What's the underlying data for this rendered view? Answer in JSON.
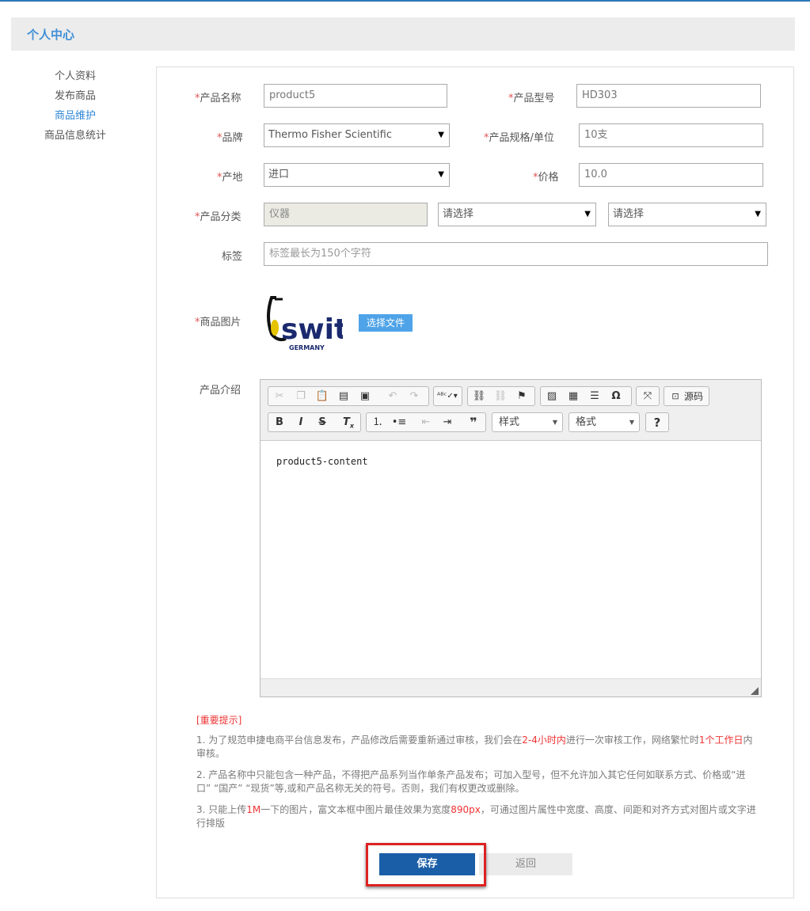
{
  "header": {
    "title": "个人中心"
  },
  "sidebar": {
    "items": [
      {
        "label": "个人资料",
        "active": false
      },
      {
        "label": "发布商品",
        "active": false
      },
      {
        "label": "商品维护",
        "active": true
      },
      {
        "label": "商品信息统计",
        "active": false
      }
    ]
  },
  "form": {
    "required_mark": "*",
    "product_name": {
      "label": "产品名称",
      "value": "product5"
    },
    "product_model": {
      "label": "产品型号",
      "value": "HD303"
    },
    "brand": {
      "label": "品牌",
      "value": "Thermo Fisher Scientific"
    },
    "spec_unit": {
      "label": "产品规格/单位",
      "value": "10支"
    },
    "origin": {
      "label": "产地",
      "value": "进口"
    },
    "price": {
      "label": "价格",
      "value": "10.0"
    },
    "category": {
      "label": "产品分类",
      "value": "仪器",
      "sub1": "请选择",
      "sub2": "请选择"
    },
    "tags": {
      "label": "标签",
      "placeholder": "标签最长为150个字符"
    },
    "image": {
      "label": "商品图片",
      "choose_file": "选择文件",
      "logo_text": "switeg",
      "logo_sub": "GERMANY"
    },
    "intro": {
      "label": "产品介绍",
      "content": "product5-content"
    }
  },
  "editor": {
    "source_label": "源码",
    "styles_label": "样式",
    "format_label": "格式",
    "help_label": "?",
    "icons": [
      "cut-icon",
      "copy-icon",
      "paste-icon",
      "paste-text-icon",
      "paste-word-icon",
      "undo-icon",
      "redo-icon",
      "spellcheck-icon",
      "link-icon",
      "unlink-icon",
      "anchor-icon",
      "image-icon",
      "table-icon",
      "hr-icon",
      "special-char-icon",
      "maximize-icon",
      "bold-icon",
      "italic-icon",
      "strike-icon",
      "remove-format-icon",
      "numbered-list-icon",
      "bulleted-list-icon",
      "outdent-icon",
      "indent-icon",
      "blockquote-icon"
    ]
  },
  "notice": {
    "title": "[重要提示]",
    "p1": {
      "a": "1. 为了规范申捷电商平台信息发布，产品修改后需要重新通过审核，我们会在",
      "r1": "2-4小时内",
      "b": "进行一次审核工作，网络繁忙时",
      "r2": "1个工作日",
      "c": "内审核。"
    },
    "p2": "2. 产品名称中只能包含一种产品，不得把产品系列当作单条产品发布；可加入型号，但不允许加入其它任何如联系方式、价格或“进口” “国产” “现货”等,或和产品名称无关的符号。否则，我们有权更改或删除。",
    "p3": {
      "a": "3. 只能上传",
      "r1": "1M",
      "b": "一下的图片，富文本框中图片最佳效果为宽度",
      "r2": "890px",
      "c": "，可通过图片属性中宽度、高度、间距和对齐方式对图片或文字进行排版"
    }
  },
  "buttons": {
    "save": "保存",
    "back": "返回"
  },
  "colors": {
    "accent": "#3f8fd6",
    "save_button": "#1a5ea7",
    "highlight_border": "#dd2222",
    "required": "#e05454"
  }
}
